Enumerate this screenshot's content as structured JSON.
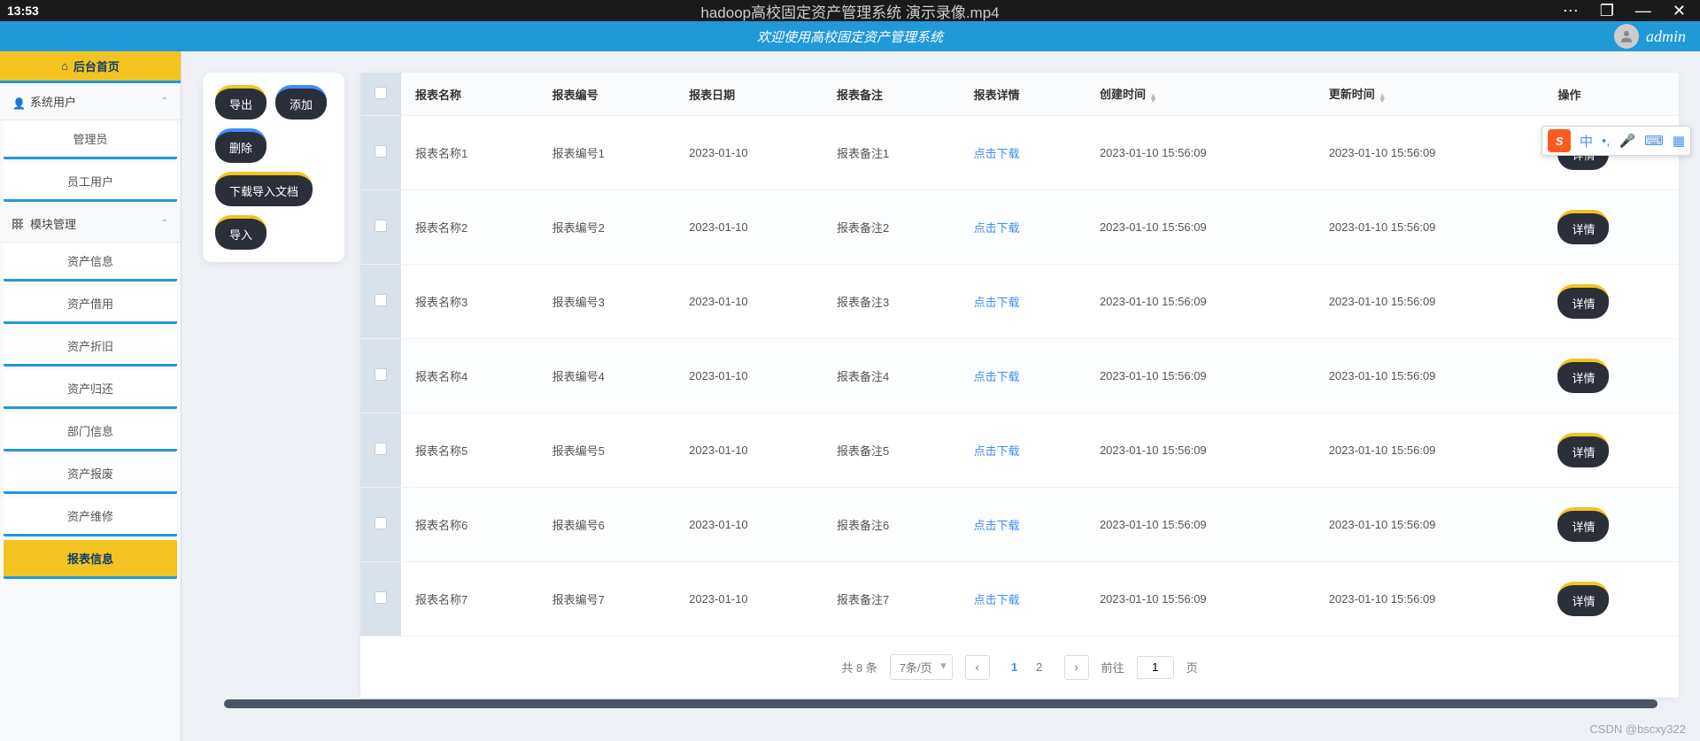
{
  "titlebar": {
    "time": "13:53",
    "title": "hadoop高校固定资产管理系统 演示录像.mp4"
  },
  "header": {
    "welcome": "欢迎使用高校固定资产管理系统",
    "username": "admin"
  },
  "sidebar": {
    "home": "后台首页",
    "groups": [
      {
        "label": "系统用户",
        "items": [
          "管理员",
          "员工用户"
        ]
      },
      {
        "label": "模块管理",
        "items": [
          "资产信息",
          "资产借用",
          "资产折旧",
          "资产归还",
          "部门信息",
          "资产报废",
          "资产维修",
          "报表信息"
        ],
        "active_index": 7
      }
    ]
  },
  "actions": {
    "export": "导出",
    "add": "添加",
    "delete": "删除",
    "download_template": "下载导入文档",
    "import": "导入"
  },
  "table": {
    "headers": {
      "name": "报表名称",
      "code": "报表编号",
      "date": "报表日期",
      "remark": "报表备注",
      "detail": "报表详情",
      "created": "创建时间",
      "updated": "更新时间",
      "ops": "操作"
    },
    "download_label": "点击下载",
    "detail_button": "详情",
    "rows": [
      {
        "name": "报表名称1",
        "code": "报表编号1",
        "date": "2023-01-10",
        "remark": "报表备注1",
        "created": "2023-01-10 15:56:09",
        "updated": "2023-01-10 15:56:09"
      },
      {
        "name": "报表名称2",
        "code": "报表编号2",
        "date": "2023-01-10",
        "remark": "报表备注2",
        "created": "2023-01-10 15:56:09",
        "updated": "2023-01-10 15:56:09"
      },
      {
        "name": "报表名称3",
        "code": "报表编号3",
        "date": "2023-01-10",
        "remark": "报表备注3",
        "created": "2023-01-10 15:56:09",
        "updated": "2023-01-10 15:56:09"
      },
      {
        "name": "报表名称4",
        "code": "报表编号4",
        "date": "2023-01-10",
        "remark": "报表备注4",
        "created": "2023-01-10 15:56:09",
        "updated": "2023-01-10 15:56:09"
      },
      {
        "name": "报表名称5",
        "code": "报表编号5",
        "date": "2023-01-10",
        "remark": "报表备注5",
        "created": "2023-01-10 15:56:09",
        "updated": "2023-01-10 15:56:09"
      },
      {
        "name": "报表名称6",
        "code": "报表编号6",
        "date": "2023-01-10",
        "remark": "报表备注6",
        "created": "2023-01-10 15:56:09",
        "updated": "2023-01-10 15:56:09"
      },
      {
        "name": "报表名称7",
        "code": "报表编号7",
        "date": "2023-01-10",
        "remark": "报表备注7",
        "created": "2023-01-10 15:56:09",
        "updated": "2023-01-10 15:56:09"
      }
    ]
  },
  "pagination": {
    "total_text": "共 8 条",
    "per_page": "7条/页",
    "pages": [
      "1",
      "2"
    ],
    "active_page": 0,
    "goto_label": "前往",
    "goto_value": "1",
    "goto_suffix": "页"
  },
  "watermark": "CSDN @bscxy322",
  "ime": {
    "logo": "S",
    "lang": "中"
  }
}
